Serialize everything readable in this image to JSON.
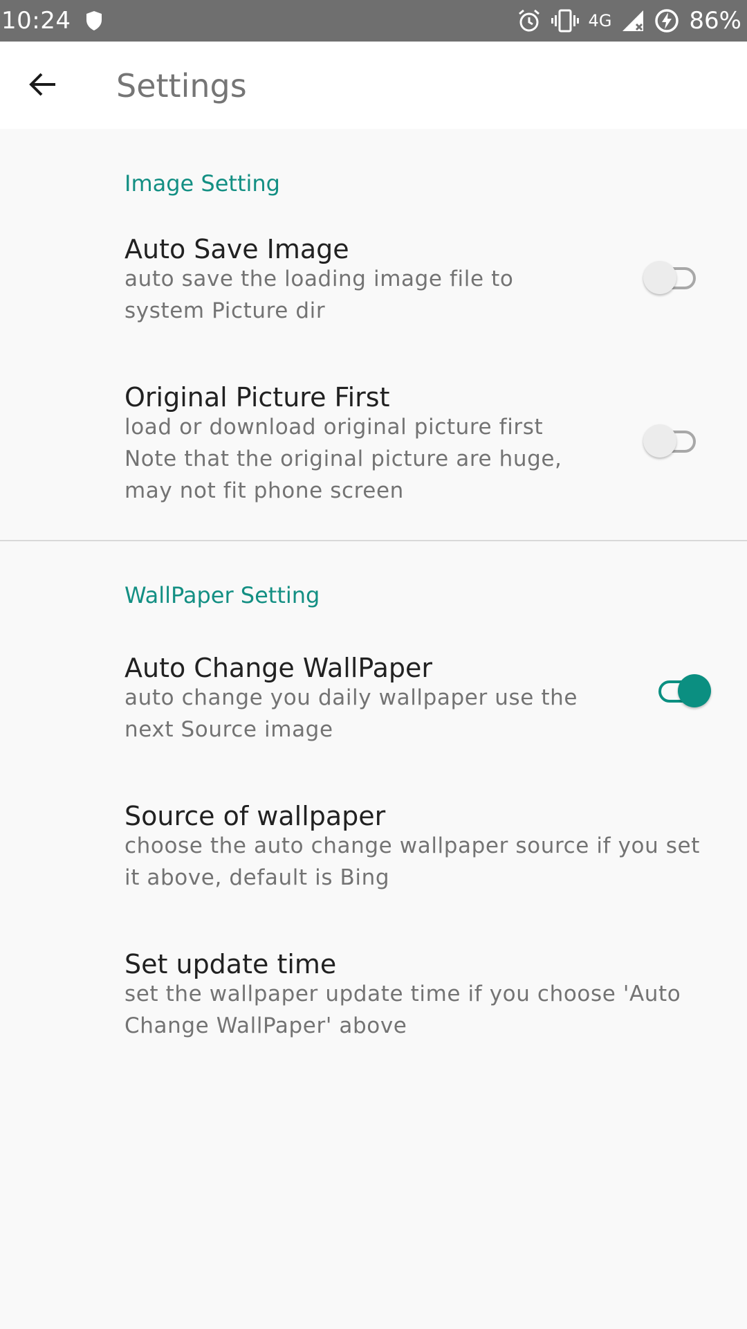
{
  "status_bar": {
    "time": "10:24",
    "left_icons": [
      "shield-icon"
    ],
    "right_icons": [
      "alarm-icon",
      "vibrate-icon",
      "signal-icon",
      "battery-saver-icon"
    ],
    "network": "4G",
    "battery": "86%"
  },
  "app_bar": {
    "back_icon": "arrow-left-icon",
    "title": "Settings"
  },
  "sections": [
    {
      "header": "Image Setting",
      "items": [
        {
          "title": "Auto Save Image",
          "summary_lines": [
            "auto save the loading image file to",
            "system Picture dir"
          ],
          "toggle": false
        },
        {
          "title": "Original Picture First",
          "summary_lines": [
            "load or download original picture first",
            "Note that the original picture are huge,",
            "may not fit phone screen"
          ],
          "toggle": false
        }
      ]
    },
    {
      "header": "WallPaper Setting",
      "items": [
        {
          "title": "Auto Change WallPaper",
          "summary_lines": [
            "auto change you daily wallpaper use the",
            "next Source image"
          ],
          "toggle": true
        },
        {
          "title": "Source of wallpaper",
          "summary_lines": [
            "choose the auto change wallpaper source if you set",
            "it above, default is Bing"
          ]
        },
        {
          "title": "Set update time",
          "summary_lines": [
            "set the wallpaper update time if you choose 'Auto",
            "Change WallPaper' above"
          ]
        }
      ]
    }
  ],
  "colors": {
    "accent": "#138f83",
    "status_bar": "#6f6f6f",
    "background": "#f9f9f9"
  }
}
